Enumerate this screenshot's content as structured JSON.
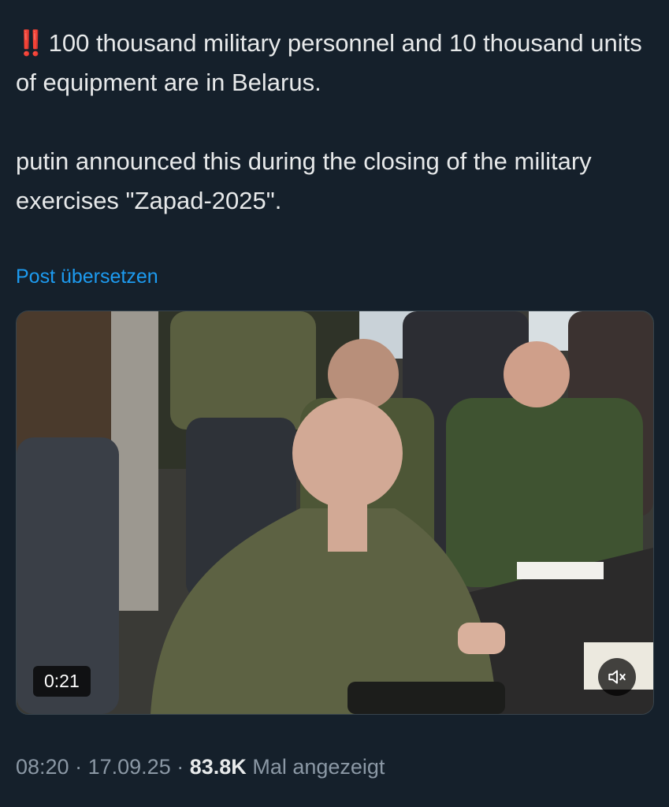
{
  "post": {
    "emoji": "‼️",
    "line1": "100 thousand military personnel and 10 thousand units of equipment are in Belarus.",
    "line2": "putin announced this during the closing of the military exercises \"Zapad-2025\"."
  },
  "translate_label": "Post übersetzen",
  "video": {
    "duration": "0:21",
    "mute_icon": "speaker-muted-icon"
  },
  "meta": {
    "time": "08:20",
    "separator": "·",
    "date": "17.09.25",
    "views_count": "83.8K",
    "views_label": "Mal angezeigt"
  },
  "colors": {
    "background": "#15202b",
    "text": "#e7e9ea",
    "link": "#1d9bf0",
    "muted": "#8b98a5",
    "emoji": "#f4212e"
  }
}
